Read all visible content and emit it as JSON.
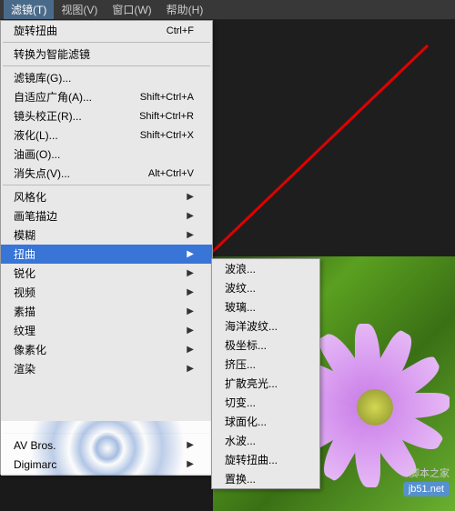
{
  "menubar": {
    "items": [
      {
        "label": "滤镜(T)",
        "active": true
      },
      {
        "label": "视图(V)"
      },
      {
        "label": "窗口(W)"
      },
      {
        "label": "帮助(H)"
      }
    ]
  },
  "menu": {
    "topItem": {
      "label": "旋转扭曲",
      "shortcut": "Ctrl+F"
    },
    "convert": {
      "label": "转换为智能滤镜"
    },
    "group1": [
      {
        "label": "滤镜库(G)...",
        "shortcut": ""
      },
      {
        "label": "自适应广角(A)...",
        "shortcut": "Shift+Ctrl+A"
      },
      {
        "label": "镜头校正(R)...",
        "shortcut": "Shift+Ctrl+R"
      },
      {
        "label": "液化(L)...",
        "shortcut": "Shift+Ctrl+X"
      },
      {
        "label": "油画(O)...",
        "shortcut": ""
      },
      {
        "label": "消失点(V)...",
        "shortcut": "Alt+Ctrl+V"
      }
    ],
    "group2": [
      {
        "label": "风格化",
        "arrow": true
      },
      {
        "label": "画笔描边",
        "arrow": true
      },
      {
        "label": "模糊",
        "arrow": true
      },
      {
        "label": "扭曲",
        "arrow": true,
        "hl": true
      },
      {
        "label": "锐化",
        "arrow": true
      },
      {
        "label": "视频",
        "arrow": true
      },
      {
        "label": "素描",
        "arrow": true
      },
      {
        "label": "纹理",
        "arrow": true
      },
      {
        "label": "像素化",
        "arrow": true
      },
      {
        "label": "渲染",
        "arrow": true
      }
    ],
    "group3": [
      {
        "label": "AV Bros.",
        "arrow": true
      },
      {
        "label": "Digimarc",
        "arrow": true
      }
    ]
  },
  "submenu": {
    "items": [
      "波浪...",
      "波纹...",
      "玻璃...",
      "海洋波纹...",
      "极坐标...",
      "挤压...",
      "扩散亮光...",
      "切变...",
      "球面化...",
      "水波...",
      "旋转扭曲...",
      "置换..."
    ]
  },
  "watermark": {
    "text1": "脚本之家",
    "text2": "jb51.net"
  }
}
